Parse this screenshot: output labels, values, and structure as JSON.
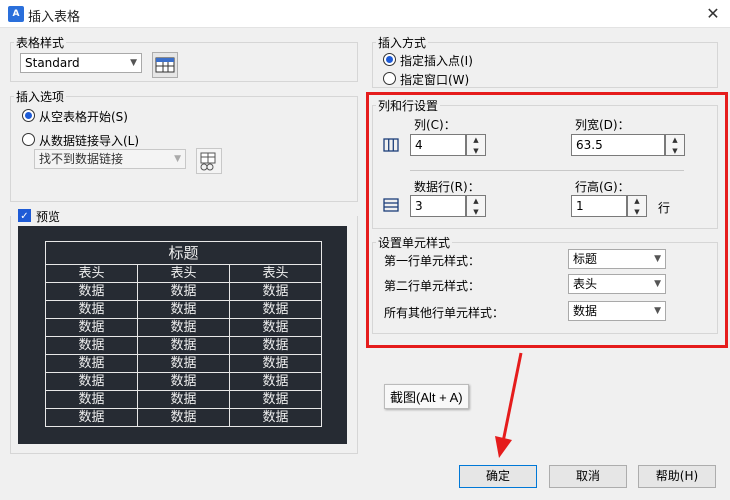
{
  "window": {
    "title": "插入表格",
    "app_icon": "A",
    "close_glyph": "✕"
  },
  "table_style": {
    "label": "表格样式",
    "selected": "Standard"
  },
  "insert_options": {
    "label": "插入选项",
    "option1": "从空表格开始(S)",
    "option2": "从数据链接导入(L)",
    "link_select": "找不到数据链接"
  },
  "preview": {
    "label": "预览",
    "title": "标题",
    "headers": [
      "表头",
      "表头",
      "表头"
    ],
    "rows": [
      [
        "数据",
        "数据",
        "数据"
      ],
      [
        "数据",
        "数据",
        "数据"
      ],
      [
        "数据",
        "数据",
        "数据"
      ],
      [
        "数据",
        "数据",
        "数据"
      ],
      [
        "数据",
        "数据",
        "数据"
      ],
      [
        "数据",
        "数据",
        "数据"
      ],
      [
        "数据",
        "数据",
        "数据"
      ],
      [
        "数据",
        "数据",
        "数据"
      ]
    ]
  },
  "insert_method": {
    "label": "插入方式",
    "option1": "指定插入点(I)",
    "option2": "指定窗口(W)"
  },
  "col_row_settings": {
    "label": "列和行设置",
    "columns_label": "列(C)：",
    "columns_value": "4",
    "col_width_label": "列宽(D)：",
    "col_width_value": "63.5",
    "data_rows_label": "数据行(R)：",
    "data_rows_value": "3",
    "row_height_label": "行高(G)：",
    "row_height_value": "1",
    "row_unit": "行"
  },
  "cell_styles": {
    "label": "设置单元样式",
    "first_row_label": "第一行单元样式：",
    "first_row_value": "标题",
    "second_row_label": "第二行单元样式：",
    "second_row_value": "表头",
    "other_rows_label": "所有其他行单元样式：",
    "other_rows_value": "数据"
  },
  "tooltip": "截图(Alt + A)",
  "buttons": {
    "ok": "确定",
    "cancel": "取消",
    "help": "帮助(H)"
  },
  "colors": {
    "highlight": "#e51c1c",
    "accent": "#1e5bd6",
    "preview_bg": "#262b33"
  }
}
